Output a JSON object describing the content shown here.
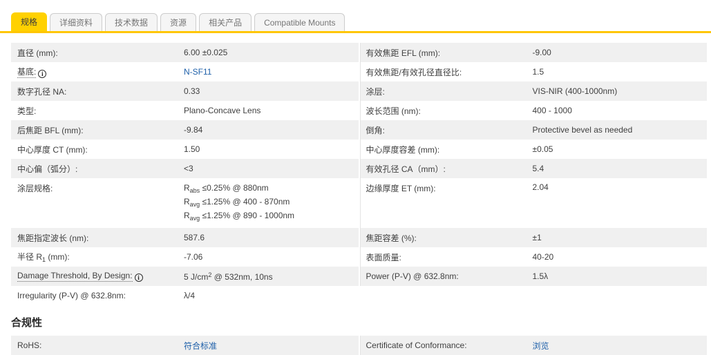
{
  "tabs": [
    {
      "label": "规格",
      "active": true
    },
    {
      "label": "详细资料",
      "active": false
    },
    {
      "label": "技术数据",
      "active": false
    },
    {
      "label": "资源",
      "active": false
    },
    {
      "label": "相关产品",
      "active": false
    },
    {
      "label": "Compatible Mounts",
      "active": false
    }
  ],
  "colors": {
    "active_tab_yellow": "#ffd100",
    "tab_underline_gold": "#ffc600",
    "link_blue": "#1d5fa9",
    "row_stripe_gray": "#f0f0f0"
  },
  "icons": {
    "info": "i"
  },
  "table": {
    "rows": [
      {
        "left": {
          "label": "直径 (mm):",
          "value": "6.00 ±0.025"
        },
        "right": {
          "label": "有效焦距 EFL (mm):",
          "value": "-9.00"
        }
      },
      {
        "left": {
          "label": "基底:",
          "value": "N-SF11"
        },
        "right": {
          "label": "有效焦距/有效孔径直径比:",
          "value": "1.5"
        }
      },
      {
        "left": {
          "label": "数字孔径 NA:",
          "value": "0.33"
        },
        "right": {
          "label": "涂层:",
          "value": "VIS-NIR (400-1000nm)"
        }
      },
      {
        "left": {
          "label": "类型:",
          "value": "Plano-Concave Lens"
        },
        "right": {
          "label": "波长范围 (nm):",
          "value": "400 - 1000"
        }
      },
      {
        "left": {
          "label": "后焦距 BFL (mm):",
          "value": "-9.84"
        },
        "right": {
          "label": "倒角:",
          "value": "Protective bevel as needed"
        }
      },
      {
        "left": {
          "label": "中心厚度 CT (mm):",
          "value": "1.50"
        },
        "right": {
          "label": "中心厚度容差 (mm):",
          "value": "±0.05"
        }
      },
      {
        "left": {
          "label": "中心偏（弧分）:",
          "value": "<3"
        },
        "right": {
          "label": "有效孔径 CA（mm）:",
          "value": "5.4"
        }
      },
      {
        "left": {
          "label": "涂层规格:",
          "value_lines": [
            {
              "base": "R",
              "sub": "abs",
              "rest": " ≤0.25% @ 880nm"
            },
            {
              "base": "R",
              "sub": "avg",
              "rest": " ≤1.25% @ 400 - 870nm"
            },
            {
              "base": "R",
              "sub": "avg",
              "rest": " ≤1.25% @ 890 - 1000nm"
            }
          ]
        },
        "right": {
          "label": "边缘厚度 ET (mm):",
          "value": "2.04"
        }
      },
      {
        "left": {
          "label": "焦距指定波长 (nm):",
          "value": "587.6"
        },
        "right": {
          "label": "焦距容差 (%):",
          "value": "±1"
        }
      },
      {
        "left": {
          "label_pre": "半径 R",
          "label_sub": "1",
          "label_post": " (mm):",
          "value": "-7.06"
        },
        "right": {
          "label": "表面质量:",
          "value": "40-20"
        }
      },
      {
        "left": {
          "label": "Damage Threshold, By Design:",
          "value_pre": "5 J/cm",
          "value_sup": "2",
          "value_post": " @ 532nm, 10ns"
        },
        "right": {
          "label": "Power (P-V) @ 632.8nm:",
          "value": "1.5λ"
        }
      },
      {
        "left": {
          "label": "Irregularity (P-V) @ 632.8nm:",
          "value": "λ/4"
        },
        "right": {
          "label": "",
          "value": ""
        }
      }
    ]
  },
  "compliance": {
    "heading": "合规性",
    "row": {
      "left": {
        "label": "RoHS:",
        "value": "符合标准"
      },
      "right": {
        "label": "Certificate of Conformance:",
        "value": "浏览"
      }
    }
  }
}
